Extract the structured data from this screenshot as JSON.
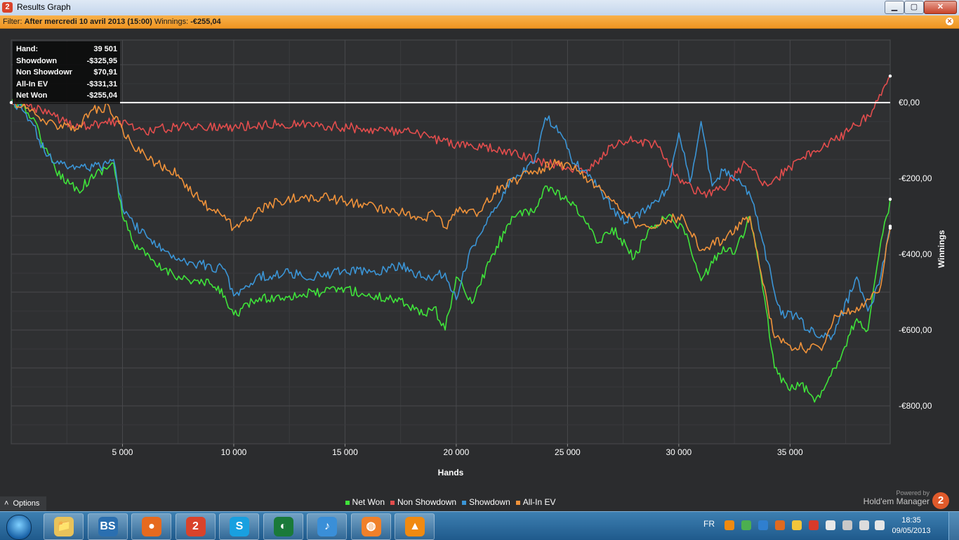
{
  "window": {
    "title": "Results Graph",
    "app_icon_text": "2",
    "buttons": {
      "minimize": "▁",
      "maximize": "▢",
      "close": "✕"
    }
  },
  "filter": {
    "label": "Filter:",
    "value": "After mercredi 10 avril 2013 (15:00)",
    "winnings_label": "Winnings:",
    "winnings_value": "-€255,04"
  },
  "stats_box": [
    {
      "key": "Hand:",
      "value": "39 501"
    },
    {
      "key": "Showdown",
      "value": "-$325,95"
    },
    {
      "key": "Non Showdown",
      "value": "$70,91"
    },
    {
      "key": "All-In EV",
      "value": "-$331,31"
    },
    {
      "key": "Net Won",
      "value": "-$255,04"
    }
  ],
  "chart_data": {
    "type": "line",
    "xlabel": "Hands",
    "ylabel": "Winnings",
    "x_ticks": [
      "5 000",
      "10 000",
      "15 000",
      "20 000",
      "25 000",
      "30 000",
      "35 000"
    ],
    "y_ticks": [
      "€0,00",
      "-€200,00",
      "-€400,00",
      "-€600,00",
      "-€800,00"
    ],
    "xlim": [
      0,
      39501
    ],
    "ylim": [
      -900,
      165
    ],
    "grid": true,
    "legend_position": "bottom",
    "series": [
      {
        "name": "Net Won",
        "color": "#3fe33a",
        "x": [
          0,
          500,
          1000,
          1500,
          2000,
          3000,
          4000,
          4600,
          5000,
          5500,
          6500,
          8000,
          9000,
          9600,
          10000,
          11000,
          12500,
          14000,
          15000,
          16000,
          17500,
          18500,
          19000,
          19500,
          20000,
          20700,
          21500,
          22500,
          23500,
          24000,
          25000,
          25700,
          26300,
          27000,
          28000,
          28700,
          29500,
          30200,
          31000,
          32000,
          32500,
          33200,
          33700,
          34300,
          35000,
          35500,
          36100,
          37000,
          38000,
          38500,
          39000,
          39501
        ],
        "y": [
          0,
          -10,
          -40,
          -120,
          -180,
          -230,
          -180,
          -160,
          -300,
          -370,
          -430,
          -470,
          -480,
          -510,
          -560,
          -520,
          -510,
          -500,
          -490,
          -510,
          -520,
          -560,
          -540,
          -600,
          -460,
          -530,
          -420,
          -300,
          -290,
          -220,
          -260,
          -300,
          -370,
          -330,
          -410,
          -330,
          -300,
          -330,
          -470,
          -380,
          -400,
          -300,
          -460,
          -700,
          -760,
          -740,
          -790,
          -700,
          -570,
          -600,
          -400,
          -255
        ]
      },
      {
        "name": "Non Showdown",
        "color": "#e34d4d",
        "x": [
          0,
          800,
          1600,
          2400,
          3200,
          4000,
          4800,
          6000,
          8000,
          10000,
          12000,
          14000,
          16000,
          18000,
          20000,
          22000,
          24000,
          25000,
          26000,
          27000,
          28000,
          29000,
          30000,
          31000,
          32000,
          33000,
          34000,
          35000,
          36000,
          37000,
          38000,
          38700,
          39501
        ],
        "y": [
          0,
          -10,
          -30,
          -50,
          -60,
          -55,
          -50,
          -75,
          -60,
          -65,
          -55,
          -60,
          -70,
          -80,
          -110,
          -125,
          -160,
          -170,
          -180,
          -110,
          -100,
          -110,
          -200,
          -240,
          -230,
          -160,
          -220,
          -170,
          -130,
          -100,
          -60,
          -20,
          70
        ]
      },
      {
        "name": "Showdown",
        "color": "#3b95d6",
        "x": [
          0,
          500,
          1000,
          1500,
          2000,
          3000,
          4000,
          4600,
          5000,
          5500,
          6500,
          8000,
          9600,
          10000,
          11000,
          12500,
          14000,
          15000,
          16000,
          17500,
          18500,
          19000,
          19500,
          20000,
          20700,
          21500,
          22500,
          23500,
          24000,
          24500,
          25300,
          26000,
          26700,
          27400,
          28000,
          28700,
          29500,
          30000,
          30500,
          31000,
          31500,
          32000,
          32700,
          33300,
          34000,
          34600,
          35200,
          35800,
          36500,
          37000,
          38000,
          38500,
          39000,
          39501
        ],
        "y": [
          0,
          -20,
          -60,
          -130,
          -160,
          -170,
          -170,
          -150,
          -280,
          -320,
          -380,
          -420,
          -440,
          -510,
          -460,
          -450,
          -460,
          -440,
          -450,
          -430,
          -460,
          -460,
          -450,
          -520,
          -380,
          -300,
          -200,
          -160,
          -40,
          -60,
          -160,
          -190,
          -250,
          -310,
          -300,
          -280,
          -230,
          -80,
          -210,
          -50,
          -220,
          -180,
          -200,
          -260,
          -420,
          -560,
          -560,
          -600,
          -620,
          -610,
          -460,
          -550,
          -480,
          -326
        ]
      },
      {
        "name": "All-In EV",
        "color": "#f0923a",
        "x": [
          0,
          500,
          1000,
          1500,
          2000,
          3000,
          3600,
          4400,
          5000,
          5500,
          6500,
          7500,
          8500,
          9500,
          10000,
          11000,
          12000,
          13000,
          14000,
          15000,
          16000,
          17500,
          18500,
          19000,
          19500,
          20000,
          21000,
          22000,
          22500,
          23500,
          24500,
          25500,
          26500,
          27000,
          28000,
          28700,
          29500,
          30200,
          31000,
          32000,
          33200,
          33700,
          34300,
          35000,
          35800,
          36500,
          37000,
          38000,
          39000,
          39501
        ],
        "y": [
          0,
          -10,
          -20,
          -50,
          -60,
          -70,
          -20,
          -10,
          -70,
          -120,
          -160,
          -190,
          -260,
          -300,
          -330,
          -290,
          -260,
          -250,
          -250,
          -260,
          -270,
          -290,
          -310,
          -290,
          -330,
          -280,
          -290,
          -220,
          -210,
          -180,
          -160,
          -180,
          -230,
          -260,
          -320,
          -330,
          -310,
          -300,
          -390,
          -360,
          -300,
          -450,
          -620,
          -640,
          -650,
          -640,
          -560,
          -540,
          -500,
          -331
        ]
      }
    ]
  },
  "bottom": {
    "options_label": "Options",
    "options_chevron": "˄",
    "powered_by": "Powered by",
    "brand": "Hold'em Manager",
    "brand_logo": "2"
  },
  "taskbar": {
    "apps": [
      {
        "name": "windows-explorer",
        "color": "#e8c25a",
        "glyph": "📁"
      },
      {
        "name": "bs-app",
        "color": "#2a6fb0",
        "glyph": "BS"
      },
      {
        "name": "firefox",
        "color": "#e66a1f",
        "glyph": "●"
      },
      {
        "name": "holdem-manager",
        "color": "#d9432b",
        "glyph": "2"
      },
      {
        "name": "skype",
        "color": "#18a0e0",
        "glyph": "S"
      },
      {
        "name": "green-app",
        "color": "#1a7a3a",
        "glyph": "◐"
      },
      {
        "name": "itunes",
        "color": "#3a8fd8",
        "glyph": "♪"
      },
      {
        "name": "orange-app",
        "color": "#f0802a",
        "glyph": "◍"
      },
      {
        "name": "vlc",
        "color": "#f08a10",
        "glyph": "▲"
      }
    ],
    "language": "FR",
    "time": "18:35",
    "date": "09/05/2013"
  }
}
